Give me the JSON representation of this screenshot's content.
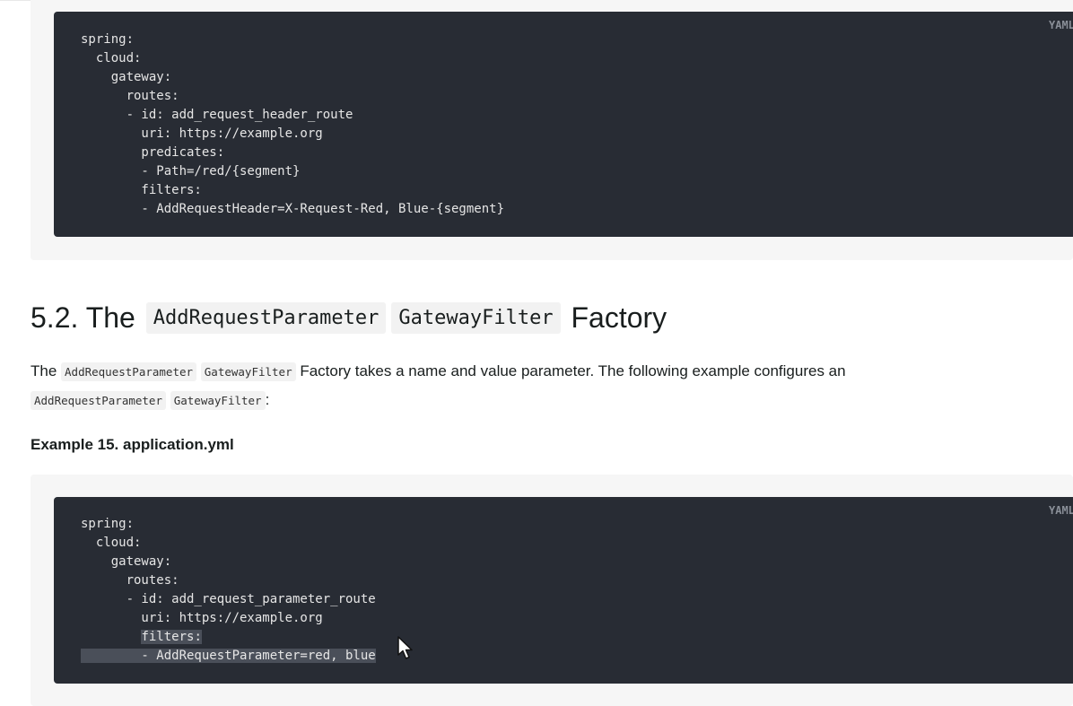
{
  "listing1": {
    "lang": "YAML",
    "lines": [
      "spring:",
      "  cloud:",
      "    gateway:",
      "      routes:",
      "      - id: add_request_header_route",
      "        uri: https://example.org",
      "        predicates:",
      "        - Path=/red/{segment}",
      "        filters:",
      "        - AddRequestHeader=X-Request-Red, Blue-{segment}"
    ]
  },
  "section": {
    "number": "5.2. The",
    "code1": "AddRequestParameter",
    "code2": "GatewayFilter",
    "suffix": "Factory"
  },
  "paragraph": {
    "word1": "The",
    "code1": "AddRequestParameter",
    "code2": "GatewayFilter",
    "text": "Factory takes a name and value parameter. The following example configures an",
    "code3": "AddRequestParameter",
    "code4": "GatewayFilter",
    "end": ":"
  },
  "example": {
    "title": "Example 15. application.yml"
  },
  "listing2": {
    "lang": "YAML",
    "lines": [
      "spring:",
      "  cloud:",
      "    gateway:",
      "      routes:",
      "      - id: add_request_parameter_route",
      "        uri: https://example.org"
    ],
    "sel_line1": "filters:",
    "sel_line1_indent": "        ",
    "sel_line2": "        - AddRequestParameter=red, blue"
  },
  "colors": {
    "code_bg": "#282c34",
    "listing_bg": "#f6f6f6",
    "selection": "#4a4f59"
  },
  "icons": {
    "cursor": "mouse-pointer-icon"
  }
}
